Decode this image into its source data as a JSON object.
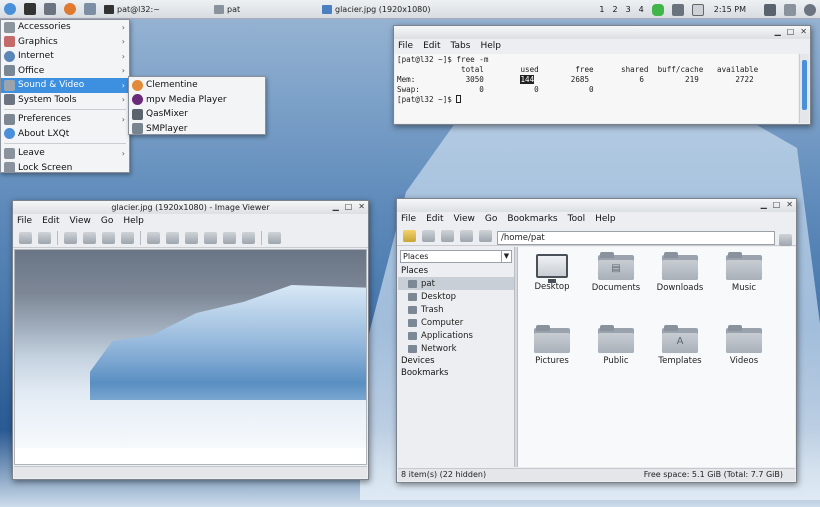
{
  "taskbar": {
    "tasks": [
      {
        "label": "pat@l32:~"
      },
      {
        "label": "pat"
      },
      {
        "label": "glacier.jpg (1920x1080)"
      }
    ],
    "desktops": [
      "1",
      "2",
      "3",
      "4"
    ],
    "clock": "2:15 PM"
  },
  "menu": {
    "items": [
      {
        "label": "Accessories"
      },
      {
        "label": "Graphics"
      },
      {
        "label": "Internet"
      },
      {
        "label": "Office"
      },
      {
        "label": "Sound & Video"
      },
      {
        "label": "System Tools"
      },
      {
        "label": "Preferences"
      },
      {
        "label": "About LXQt"
      },
      {
        "label": "Leave"
      },
      {
        "label": "Lock Screen"
      }
    ],
    "submenu": [
      "Clementine",
      "mpv Media Player",
      "QasMixer",
      "SMPlayer"
    ]
  },
  "terminal": {
    "menus": [
      "File",
      "Edit",
      "Tabs",
      "Help"
    ],
    "line1": "[pat@l32 ~]$ free -m",
    "header": "              total        used        free      shared  buff/cache   available",
    "mem_label": "Mem:",
    "mem_total": "3050",
    "mem_used": "144",
    "mem_rest": "        2685           6         219        2722",
    "swap": "Swap:             0           0           0",
    "prompt": "[pat@l32 ~]$ "
  },
  "viewer": {
    "title": "glacier.jpg (1920x1080) - Image Viewer",
    "menus": [
      "File",
      "Edit",
      "View",
      "Go",
      "Help"
    ]
  },
  "filemanager": {
    "menus": [
      "File",
      "Edit",
      "View",
      "Go",
      "Bookmarks",
      "Tool",
      "Help"
    ],
    "path": "/home/pat",
    "places_select": "Places",
    "places_head": "Places",
    "places": [
      "pat",
      "Desktop",
      "Trash",
      "Computer",
      "Applications",
      "Network"
    ],
    "devices": "Devices",
    "bookmarks": "Bookmarks",
    "items": [
      "Desktop",
      "Documents",
      "Downloads",
      "Music",
      "Pictures",
      "Public",
      "Templates",
      "Videos"
    ],
    "status_left": "8 item(s) (22 hidden)",
    "status_right": "Free space: 5.1 GiB (Total: 7.7 GiB)"
  }
}
